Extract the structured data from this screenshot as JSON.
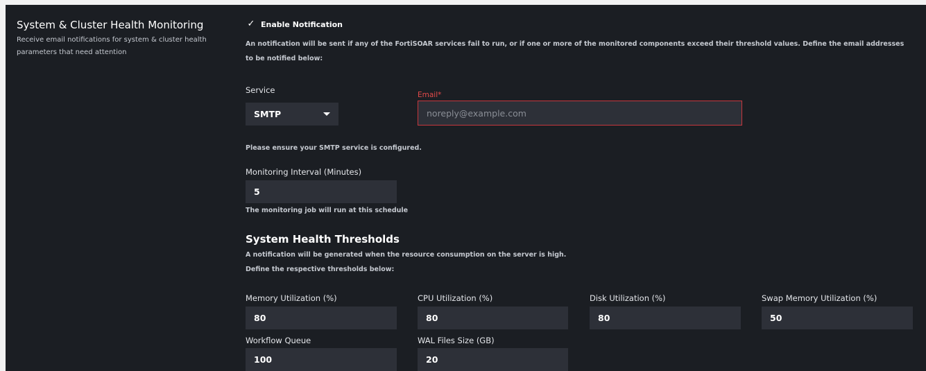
{
  "section": {
    "title": "System & Cluster Health Monitoring",
    "description": "Receive email notifications for system & cluster health parameters that need attention"
  },
  "notification": {
    "checkbox_mark": "✓",
    "label": "Enable Notification",
    "checked": true,
    "info": "An notification will be sent if any of the FortiSOAR services fail to run, or if one or more of the monitored components exceed their threshold values. Define the email addresses to be notified below:"
  },
  "service": {
    "label": "Service",
    "value": "SMTP"
  },
  "email": {
    "label": "Email*",
    "placeholder": "noreply@example.com",
    "value": ""
  },
  "smtp_hint": "Please ensure your SMTP service is configured.",
  "interval": {
    "label": "Monitoring Interval (Minutes)",
    "value": "5",
    "hint": "The monitoring job will run at this schedule"
  },
  "thresholds": {
    "title": "System Health Thresholds",
    "desc_line1": "A notification will be generated when the resource consumption on the server is high.",
    "desc_line2": "Define the respective thresholds below:",
    "memory": {
      "label": "Memory Utilization (%)",
      "value": "80"
    },
    "cpu": {
      "label": "CPU Utilization (%)",
      "value": "80"
    },
    "disk": {
      "label": "Disk Utilization (%)",
      "value": "80"
    },
    "swap": {
      "label": "Swap Memory Utilization (%)",
      "value": "50"
    },
    "workflow": {
      "label": "Workflow Queue",
      "value": "100"
    },
    "wal": {
      "label": "WAL Files Size (GB)",
      "value": "20"
    }
  },
  "colors": {
    "panel_bg": "#1b1e23",
    "input_bg": "#2d3038",
    "error_red": "#e34a4a"
  }
}
